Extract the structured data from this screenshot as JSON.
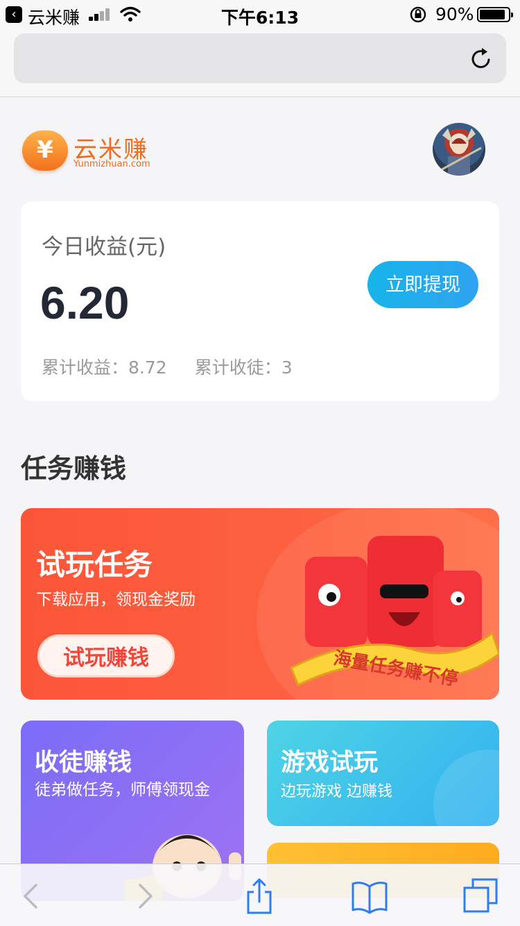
{
  "status_bar": {
    "back_app": "云米赚",
    "time": "下午6:13",
    "battery": "90%",
    "battery_level": 0.9
  },
  "header": {
    "logo_symbol": "¥",
    "logo_name": "云米赚",
    "logo_domain": "Yunmizhuan.com"
  },
  "earnings": {
    "label": "今日收益(元)",
    "amount": "6.20",
    "withdraw_label": "立即提现",
    "total_label": "累计收益：",
    "total_value": "8.72",
    "apprentice_label": "累计收徒：",
    "apprentice_value": "3"
  },
  "section": {
    "title": "任务赚钱"
  },
  "trial": {
    "title": "试玩任务",
    "subtitle": "下载应用，领现金奖励",
    "cta": "试玩赚钱",
    "ribbon": "海量任务赚不停"
  },
  "invite": {
    "title": "收徒赚钱",
    "subtitle": "徒弟做任务，师傅领现金"
  },
  "game": {
    "title": "游戏试玩",
    "subtitle": "边玩游戏 边赚钱"
  },
  "colors": {
    "accent_blue": "#1aaee9",
    "trial_red": "#fd5a3c",
    "invite_purple": "#8b6ff5",
    "game_cyan": "#3ec1ec",
    "brand_orange": "#f26a1b"
  }
}
